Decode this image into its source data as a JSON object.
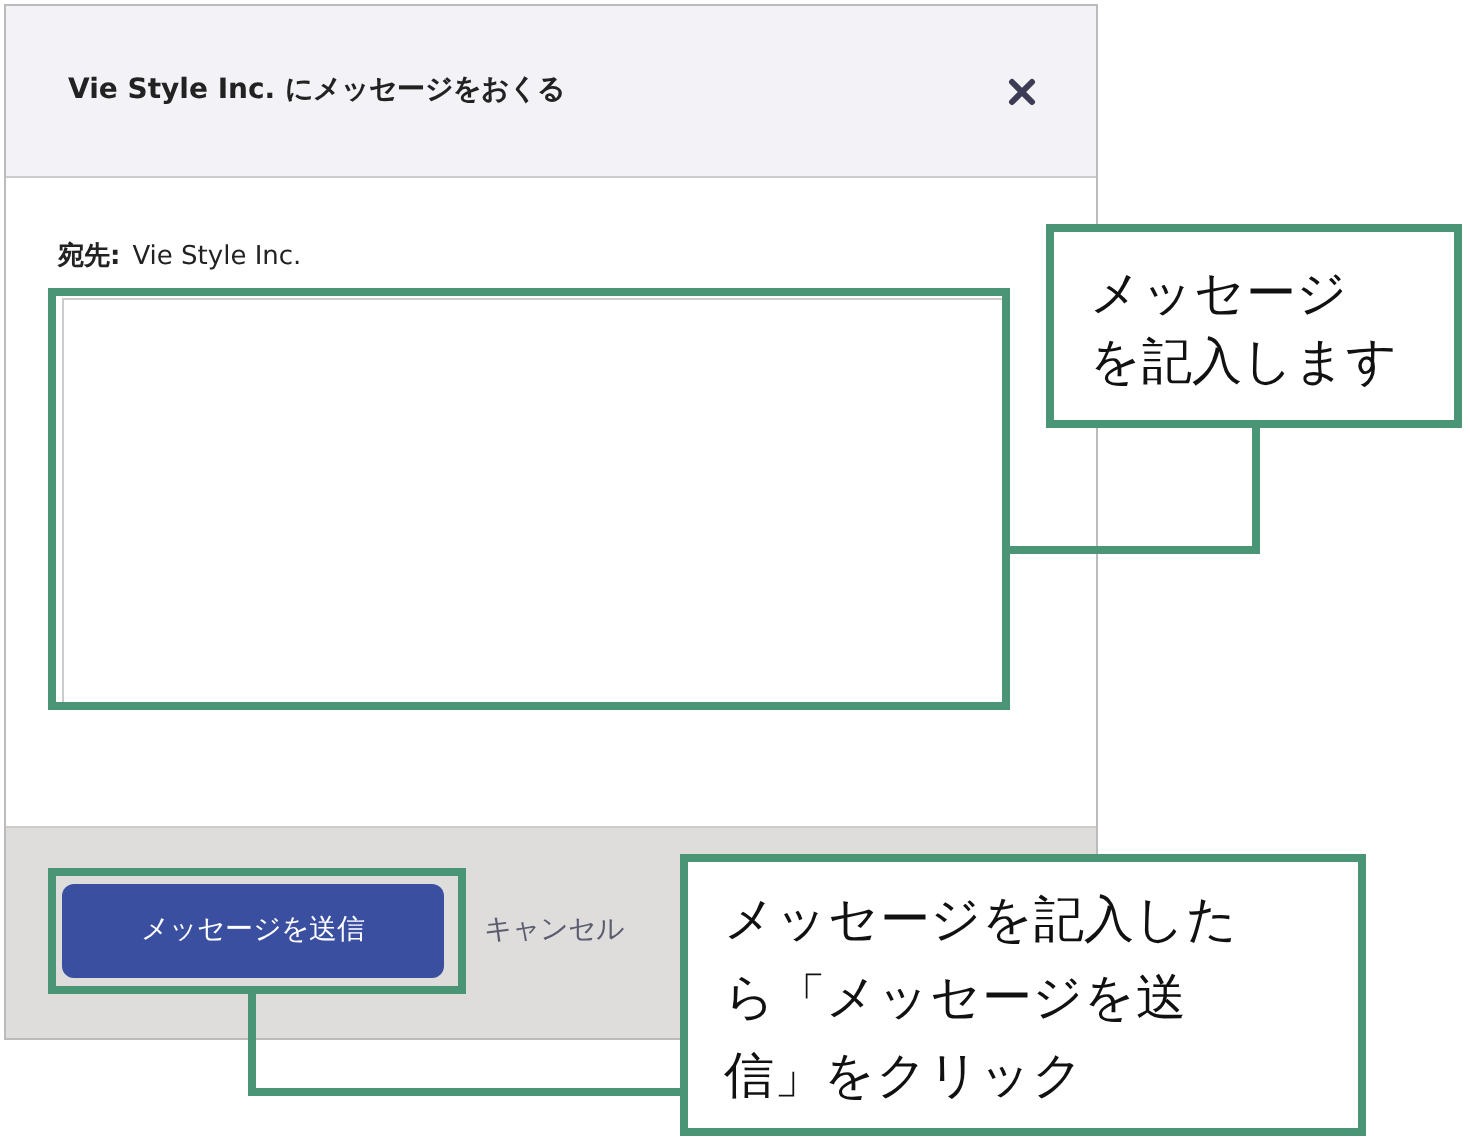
{
  "dialog": {
    "title": "Vie Style Inc. にメッセージをおくる",
    "recipient_label": "宛先:",
    "recipient": "Vie Style Inc.",
    "send_button": "メッセージを送信",
    "cancel_link": "キャンセル"
  },
  "annotations": [
    {
      "text": "メッセージを記入します"
    },
    {
      "text": "メッセージを記入したら「メッセージを送信」をクリック"
    }
  ]
}
